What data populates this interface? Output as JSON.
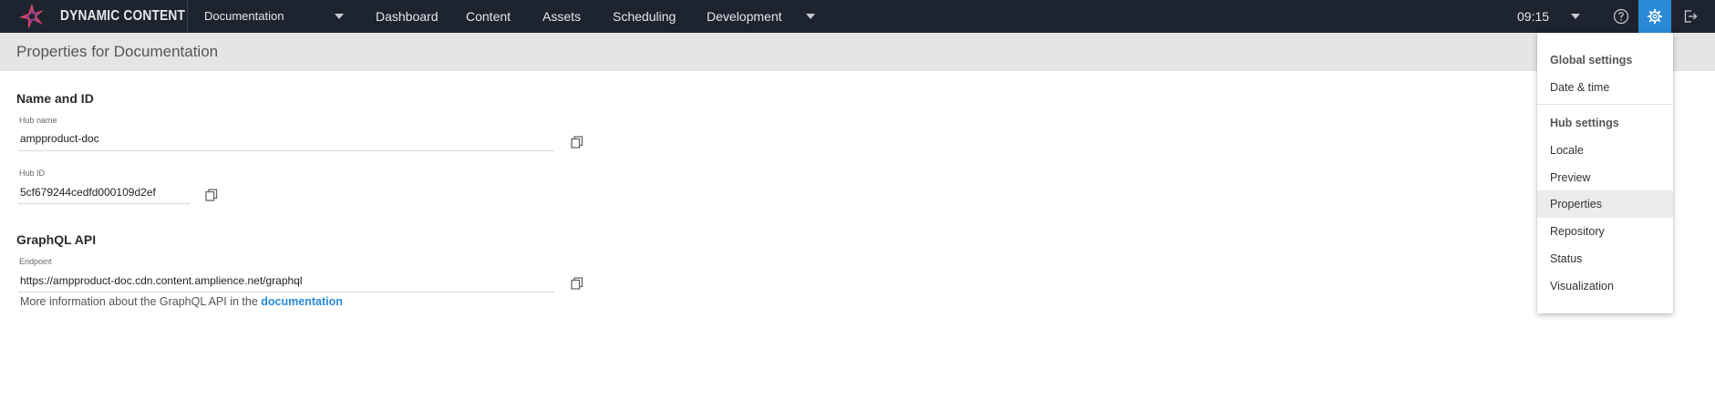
{
  "app": {
    "brand": "DYNAMIC CONTENT",
    "hub": "Documentation",
    "nav": [
      "Dashboard",
      "Content",
      "Assets",
      "Scheduling",
      "Development"
    ],
    "time": "09:15"
  },
  "page": {
    "title": "Properties for Documentation"
  },
  "sections": {
    "name_id": {
      "title": "Name and ID",
      "hub_name_label": "Hub name",
      "hub_name_value": "ampproduct-doc",
      "hub_id_label": "Hub ID",
      "hub_id_value": "5cf679244cedfd000109d2ef"
    },
    "graphql": {
      "title": "GraphQL API",
      "endpoint_label": "Endpoint",
      "endpoint_value": "https://ampproduct-doc.cdn.content.amplience.net/graphql",
      "info_text": "More information about the GraphQL API in the ",
      "info_link": "documentation"
    }
  },
  "settings_menu": {
    "global_heading": "Global settings",
    "date_time": "Date & time",
    "hub_heading": "Hub settings",
    "items": [
      "Locale",
      "Preview",
      "Properties",
      "Repository",
      "Status",
      "Visualization"
    ],
    "selected": "Properties"
  },
  "colors": {
    "topbar": "#1e2330",
    "accent": "#2a8ad8",
    "header": "#e5e5e5"
  }
}
